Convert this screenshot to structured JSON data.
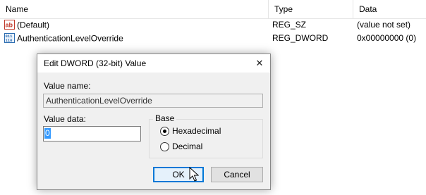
{
  "columns": {
    "name": "Name",
    "type": "Type",
    "data": "Data"
  },
  "rows": [
    {
      "icon": "string-value-icon",
      "name": "(Default)",
      "type": "REG_SZ",
      "data": "(value not set)"
    },
    {
      "icon": "binary-value-icon",
      "name": "AuthenticationLevelOverride",
      "type": "REG_DWORD",
      "data": "0x00000000 (0)"
    }
  ],
  "dialog": {
    "title": "Edit DWORD (32-bit) Value",
    "close_glyph": "✕",
    "value_name_label": "Value name:",
    "value_name": "AuthenticationLevelOverride",
    "value_data_label": "Value data:",
    "value_data": "0",
    "base_label": "Base",
    "base_options": [
      {
        "label": "Hexadecimal",
        "selected": true
      },
      {
        "label": "Decimal",
        "selected": false
      }
    ],
    "ok_label": "OK",
    "cancel_label": "Cancel"
  },
  "colors": {
    "accent": "#0078d7",
    "selection": "#3399ff",
    "dialog_bg": "#f0f0f0"
  }
}
